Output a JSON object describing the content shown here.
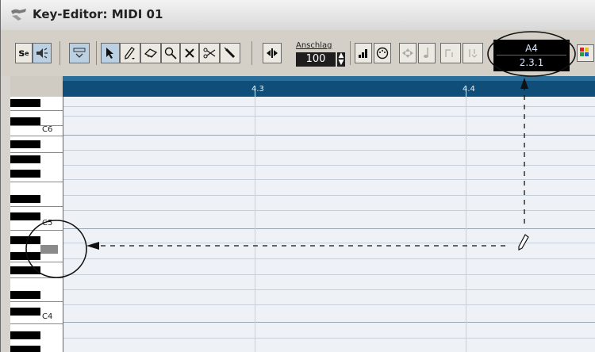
{
  "window": {
    "title": "Key-Editor: MIDI 01"
  },
  "toolbar": {
    "solo_label": "s",
    "velocity_label": "Anschlag",
    "velocity_value": "100"
  },
  "position_display": {
    "pitch": "A4",
    "position": "2.3.1"
  },
  "ruler": {
    "marks": [
      "4.3",
      "4.4"
    ]
  },
  "keyboard": {
    "labels": [
      "C6",
      "C5",
      "C4"
    ]
  }
}
